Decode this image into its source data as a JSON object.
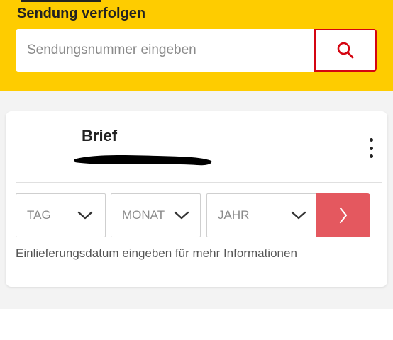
{
  "header": {
    "title": "Sendung verfolgen",
    "background_color": "#fecc00"
  },
  "search": {
    "placeholder": "Sendungsnummer eingeben",
    "value": "",
    "button_icon": "search-icon",
    "accent_color": "#d40511"
  },
  "card": {
    "title": "Brief",
    "tracking_number_redacted": true,
    "menu_icon": "more-vertical-icon",
    "date_fields": {
      "day_label": "TAG",
      "month_label": "MONAT",
      "year_label": "JAHR",
      "chevron_icon": "chevron-down-icon",
      "submit_icon": "chevron-right-icon",
      "submit_color": "#e4585f"
    },
    "helper_text": "Einlieferungsdatum eingeben für mehr Informationen"
  }
}
